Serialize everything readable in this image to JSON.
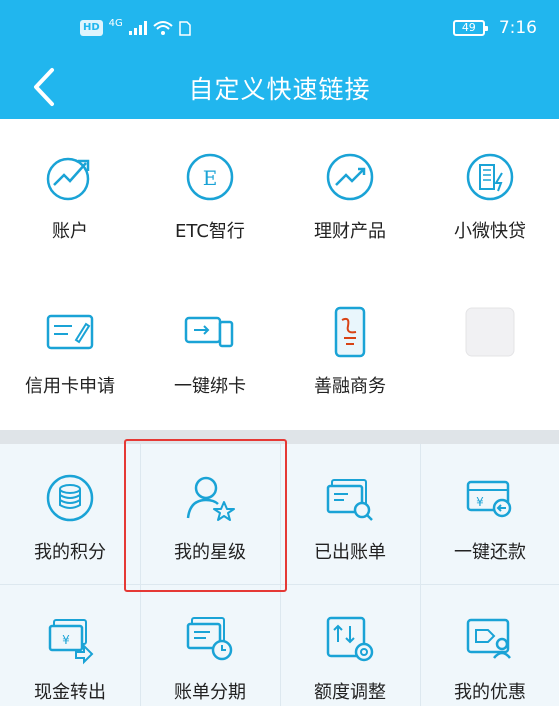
{
  "status_bar": {
    "hd": "HD",
    "network": "4G",
    "battery": "49",
    "time": "7:16"
  },
  "header": {
    "title": "自定义快速链接"
  },
  "top_links": [
    {
      "label": "账户",
      "icon": "account-chart-icon"
    },
    {
      "label": "ETC智行",
      "icon": "etc-icon"
    },
    {
      "label": "理财产品",
      "icon": "finance-chart-icon"
    },
    {
      "label": "小微快贷",
      "icon": "building-loan-icon"
    },
    {
      "label": "信用卡申请",
      "icon": "card-application-icon"
    },
    {
      "label": "一键绑卡",
      "icon": "bind-card-icon"
    },
    {
      "label": "善融商务",
      "icon": "phone-shop-icon"
    },
    {
      "label": "",
      "icon": "placeholder-icon"
    }
  ],
  "bottom_links": [
    {
      "label": "我的积分",
      "icon": "points-coins-icon"
    },
    {
      "label": "我的星级",
      "icon": "user-star-icon"
    },
    {
      "label": "已出账单",
      "icon": "bill-search-icon"
    },
    {
      "label": "一键还款",
      "icon": "repay-card-icon"
    },
    {
      "label": "现金转出",
      "icon": "cash-transfer-icon"
    },
    {
      "label": "账单分期",
      "icon": "installment-clock-icon"
    },
    {
      "label": "额度调整",
      "icon": "limit-adjust-icon"
    },
    {
      "label": "我的优惠",
      "icon": "coupon-user-icon"
    }
  ],
  "colors": {
    "header": "#21b6ee",
    "icon_stroke": "#1aa3d6",
    "highlight": "#e53935"
  }
}
